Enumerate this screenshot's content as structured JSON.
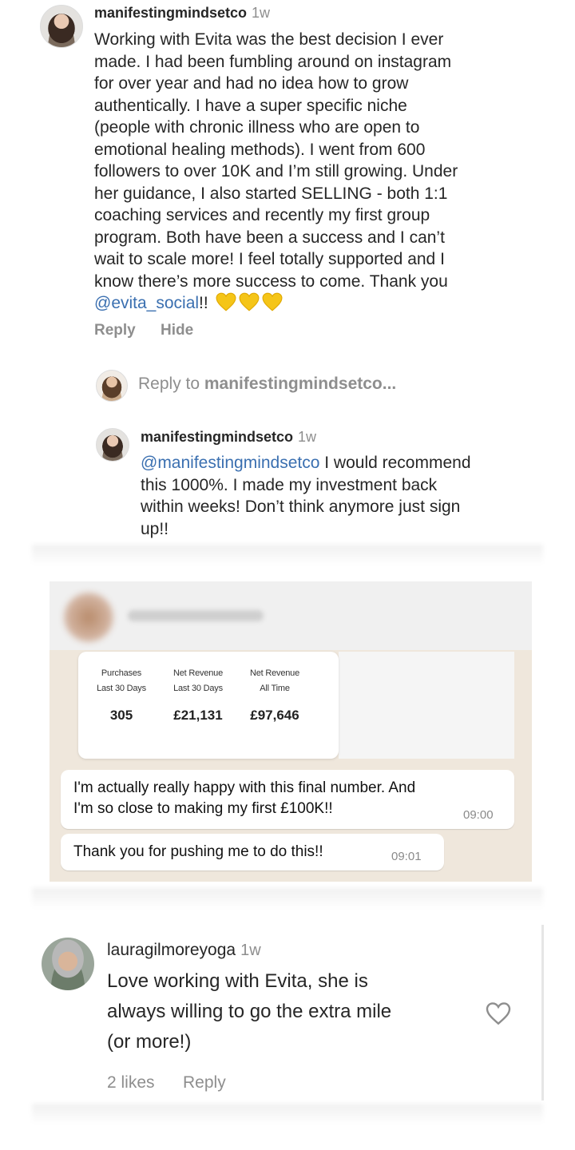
{
  "comment1": {
    "username": "manifestingmindsetco",
    "time": "1w",
    "lines": [
      "Working with Evita was the best decision I ever",
      "made. I had been fumbling around on instagram",
      "for over year and had no idea how to grow",
      "authentically. I have a super specific niche",
      "(people with chronic illness who are open to",
      "emotional healing methods). I went from 600",
      "followers to over 10K and I’m still growing. Under",
      "her guidance, I also started SELLING - both 1:1",
      "coaching services and recently my first group",
      "program. Both have been a success and I can’t",
      "wait to scale more! I feel totally supported and I",
      "know there’s more success to come. Thank you"
    ],
    "mention": "@evita_social",
    "suffix": "!!",
    "emoji_icon": "yellow-heart-icon",
    "reply_label": "Reply",
    "hide_label": "Hide"
  },
  "reply_to": {
    "prefix": "Reply to ",
    "username": "manifestingmindsetco..."
  },
  "comment2": {
    "username": "manifestingmindsetco",
    "time": "1w",
    "mention": "@manifestingmindsetco",
    "line1_rest": " I would recommend",
    "lines": [
      "this 1000%. I made my investment back",
      "within weeks! Don’t think anymore just sign",
      "up!!"
    ]
  },
  "whatsapp": {
    "stats": [
      {
        "label1": "Purchases",
        "label2": "Last 30 Days",
        "value": "305"
      },
      {
        "label1": "Net Revenue",
        "label2": "Last 30 Days",
        "value": "£21,131"
      },
      {
        "label1": "Net Revenue",
        "label2": "All Time",
        "value": "£97,646"
      }
    ],
    "message1": {
      "line1": "I'm actually really happy with this final number. And",
      "line2": "I'm so close to making my first £100K!!",
      "time": "09:00"
    },
    "message2": {
      "text": "Thank you for pushing me to do this!!",
      "time": "09:01"
    }
  },
  "comment3": {
    "username": "lauragilmoreyoga",
    "time": "1w",
    "lines": [
      "Love working with Evita, she is",
      "always willing to go the extra mile",
      "(or more!)"
    ],
    "likes_label": "2 likes",
    "reply_label": "Reply"
  },
  "colors": {
    "mention": "#3a6fb0",
    "muted": "#8e8e8e",
    "heart": "#f5c518",
    "whatsapp_bg": "#efe7dc"
  }
}
